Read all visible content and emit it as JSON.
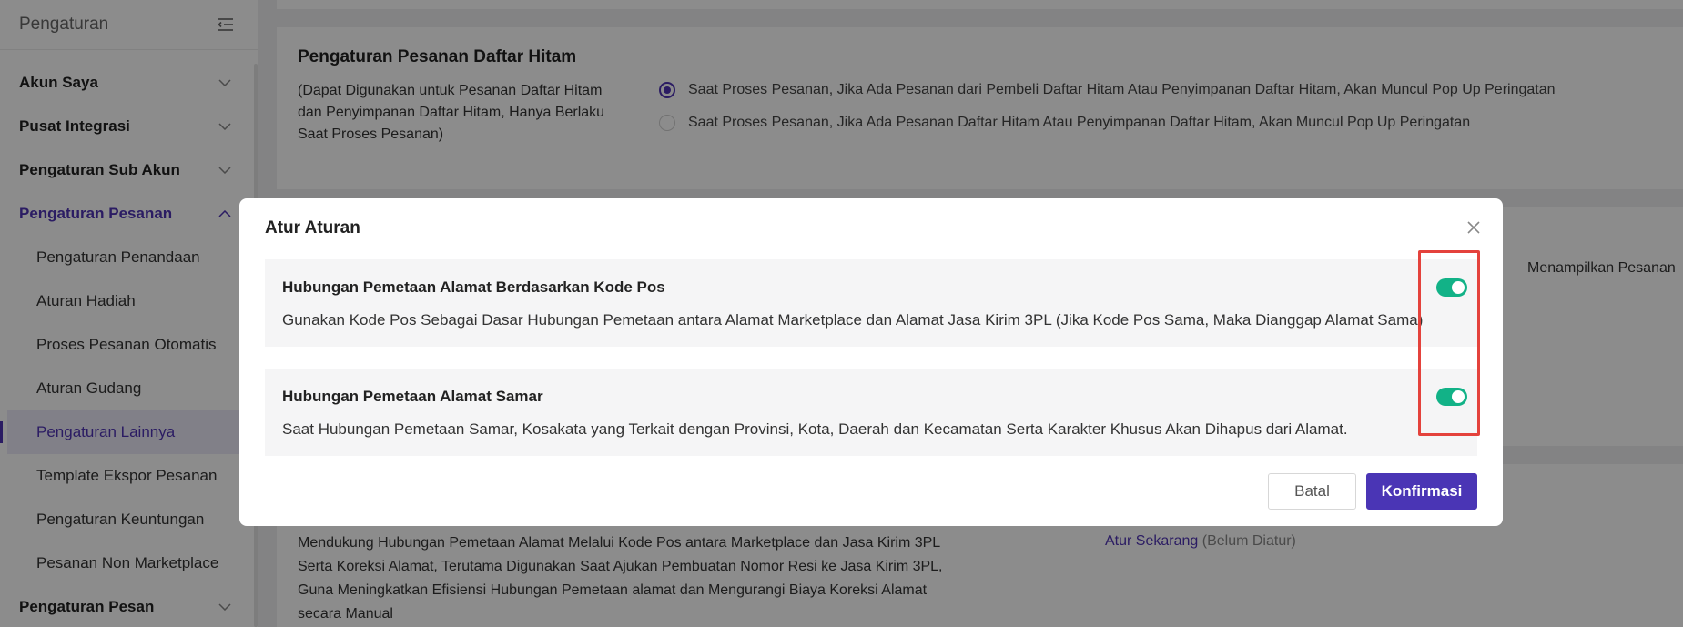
{
  "sidebar": {
    "title": "Pengaturan",
    "menu": [
      {
        "label": "Akun Saya",
        "expanded": false
      },
      {
        "label": "Pusat Integrasi",
        "expanded": false
      },
      {
        "label": "Pengaturan Sub Akun",
        "expanded": false
      },
      {
        "label": "Pengaturan Pesanan",
        "expanded": true
      }
    ],
    "submenu": [
      "Pengaturan Penandaan",
      "Aturan Hadiah",
      "Proses Pesanan Otomatis",
      "Aturan Gudang",
      "Pengaturan Lainnya",
      "Template Ekspor Pesanan",
      "Pengaturan Keuntungan",
      "Pesanan Non Marketplace"
    ],
    "selected_submenu": "Pengaturan Lainnya",
    "bottom_menu": "Pengaturan Pesan"
  },
  "blacklist_card": {
    "title": "Pengaturan Pesanan Daftar Hitam",
    "desc_lines": [
      "(Dapat Digunakan untuk Pesanan Daftar Hitam",
      "dan Penyimpanan Daftar Hitam, Hanya Berlaku",
      "Saat Proses Pesanan)"
    ],
    "options": [
      {
        "label": "Saat Proses Pesanan, Jika Ada Pesanan dari Pembeli Daftar Hitam Atau Penyimpanan Daftar Hitam, Akan Muncul Pop Up Peringatan",
        "checked": true
      },
      {
        "label": "Saat Proses Pesanan, Jika Ada Pesanan Daftar Hitam Atau Penyimpanan Daftar Hitam, Akan Muncul Pop Up Peringatan",
        "checked": false
      }
    ]
  },
  "partial_text": "Menampilkan Pesanan",
  "address_card": {
    "desc_lines": [
      "Mendukung Hubungan Pemetaan Alamat Melalui Kode Pos antara Marketplace dan Jasa Kirim 3PL",
      "Serta Koreksi Alamat, Terutama Digunakan Saat Ajukan Pembuatan Nomor Resi ke Jasa Kirim 3PL,",
      "Guna Meningkatkan Efisiensi Hubungan Pemetaan alamat dan Mengurangi Biaya Koreksi Alamat",
      "secara Manual"
    ],
    "action_link": "Atur Sekarang",
    "action_status": "(Belum Diatur)"
  },
  "modal": {
    "title": "Atur Aturan",
    "rules": [
      {
        "title": "Hubungan Pemetaan Alamat Berdasarkan Kode Pos",
        "desc": "Gunakan Kode Pos Sebagai Dasar Hubungan Pemetaan antara Alamat Marketplace dan Alamat Jasa Kirim 3PL (Jika Kode Pos Sama, Maka Dianggap Alamat Sama)",
        "enabled": true
      },
      {
        "title": "Hubungan Pemetaan Alamat Samar",
        "desc": "Saat Hubungan Pemetaan Samar, Kosakata yang Terkait dengan Provinsi, Kota, Daerah dan Kecamatan Serta Karakter Khusus Akan Dihapus dari Alamat.",
        "enabled": true
      }
    ],
    "cancel_label": "Batal",
    "confirm_label": "Konfirmasi"
  },
  "colors": {
    "accent": "#4f34b5",
    "toggle_on": "#12b287",
    "highlight": "#e4423c"
  },
  "icons": {
    "collapse": "menu-fold-icon",
    "chevron_down": "chevron-down-icon",
    "chevron_up": "chevron-up-icon",
    "close": "close-icon"
  }
}
